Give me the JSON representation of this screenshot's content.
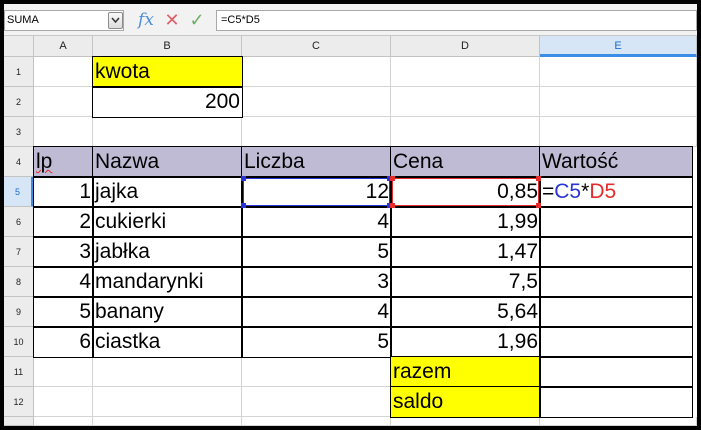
{
  "formula_bar": {
    "name_box": "SUMA",
    "fx_icon": "fx",
    "cancel_icon": "✕",
    "accept_icon": "✓",
    "formula": "=C5*D5"
  },
  "columns": [
    "A",
    "B",
    "C",
    "D",
    "E"
  ],
  "rows": [
    "1",
    "2",
    "3",
    "4",
    "5",
    "6",
    "7",
    "8",
    "9",
    "10",
    "11",
    "12"
  ],
  "cells": {
    "kwota_label": "kwota",
    "kwota_value": "200",
    "headers": {
      "lp": "lp",
      "nazwa": "Nazwa",
      "liczba": "Liczba",
      "cena": "Cena",
      "wartosc": "Wartość"
    },
    "items": [
      {
        "lp": "1",
        "nazwa": "jajka",
        "liczba": "12",
        "cena": "0,85"
      },
      {
        "lp": "2",
        "nazwa": "cukierki",
        "liczba": "4",
        "cena": "1,99"
      },
      {
        "lp": "3",
        "nazwa": "jabłka",
        "liczba": "5",
        "cena": "1,47"
      },
      {
        "lp": "4",
        "nazwa": "mandarynki",
        "liczba": "3",
        "cena": "7,5"
      },
      {
        "lp": "5",
        "nazwa": "banany",
        "liczba": "4",
        "cena": "5,64"
      },
      {
        "lp": "6",
        "nazwa": "ciastka",
        "liczba": "5",
        "cena": "1,96"
      }
    ],
    "edit_formula": {
      "eq": "=",
      "ref1": "C5",
      "op": "*",
      "ref2": "D5"
    },
    "razem_label": "razem",
    "saldo_label": "saldo"
  },
  "active_cell": "E5",
  "colors": {
    "highlight": "#ffff00",
    "header_fill": "#bfbbd4",
    "ref_c5": "#2a35d6",
    "ref_d5": "#e52b2b"
  }
}
